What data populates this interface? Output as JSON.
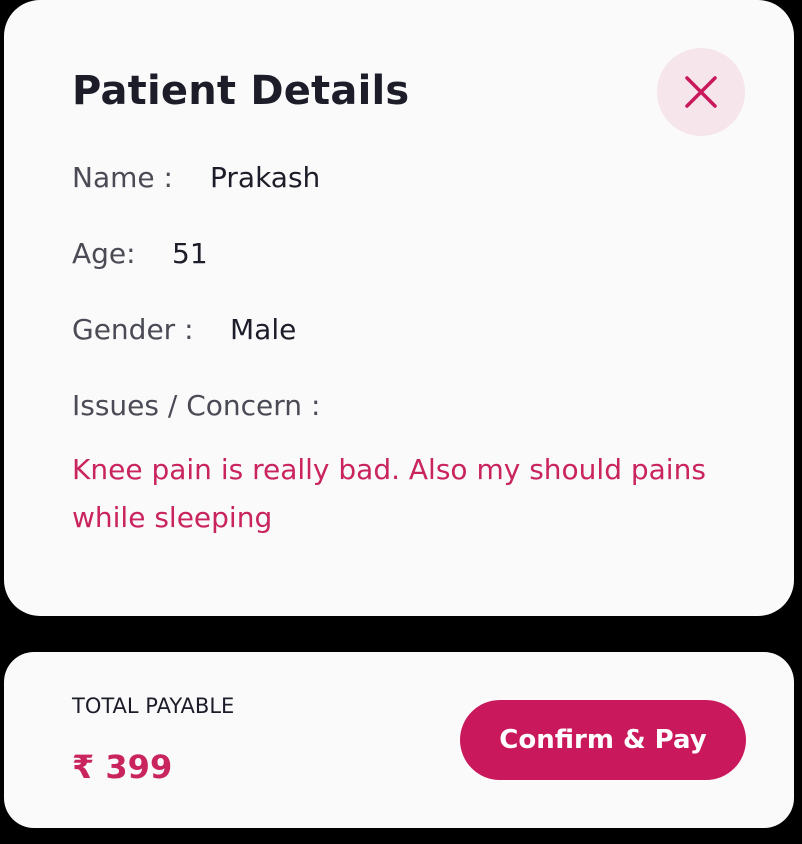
{
  "patient_details": {
    "title": "Patient Details",
    "close_icon": "close-icon",
    "name_label": "Name :",
    "name_value": "Prakash",
    "age_label": "Age:",
    "age_value": "51",
    "gender_label": "Gender :",
    "gender_value": "Male",
    "concern_label": "Issues / Concern :",
    "concern_text": "Knee pain is really bad. Also my should pains while sleeping"
  },
  "payment": {
    "total_label": "TOTAL PAYABLE",
    "total_amount": "₹ 399",
    "confirm_label": "Confirm & Pay"
  },
  "colors": {
    "accent": "#c9185b",
    "accent_text": "#c9245e",
    "close_bg": "#f7e5ec",
    "card_bg": "#fafafb",
    "text_primary": "#1c1d29",
    "text_secondary": "#4a4b55"
  }
}
